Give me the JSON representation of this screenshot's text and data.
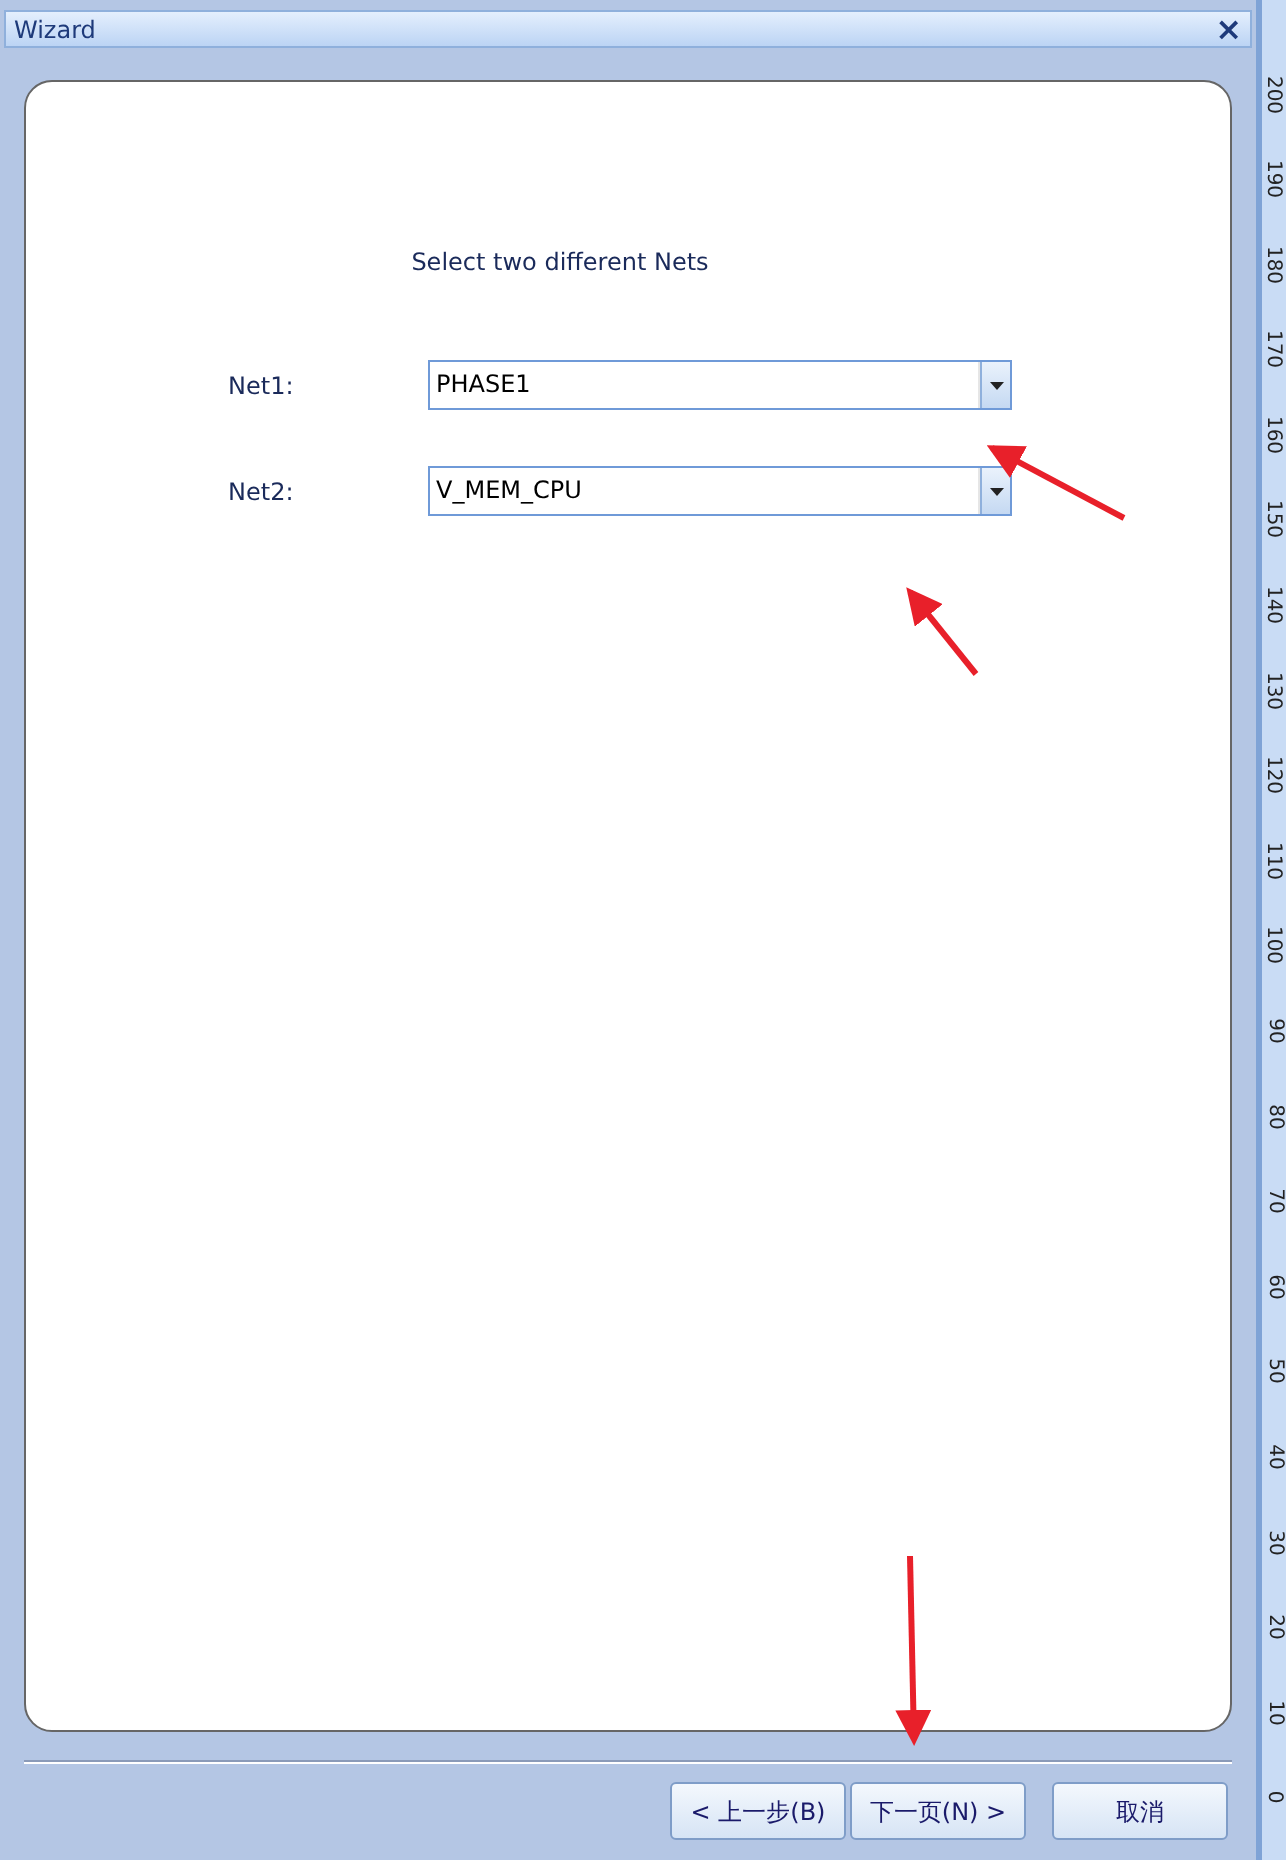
{
  "window": {
    "title": "Wizard",
    "close": "×"
  },
  "heading": "Select two different Nets",
  "fields": [
    {
      "label": "Net1:",
      "value": "PHASE1"
    },
    {
      "label": "Net2:",
      "value": "V_MEM_CPU"
    }
  ],
  "buttons": [
    {
      "label": "< 上一步(B)"
    },
    {
      "label": "下一页(N) >"
    },
    {
      "label": "取消"
    }
  ],
  "ruler": {
    "labels": [
      "200",
      "190",
      "180",
      "170",
      "160",
      "150",
      "140",
      "130",
      "120",
      "110",
      "100",
      "90",
      "80",
      "70",
      "60",
      "50",
      "40",
      "30",
      "20",
      "10",
      "0"
    ]
  }
}
